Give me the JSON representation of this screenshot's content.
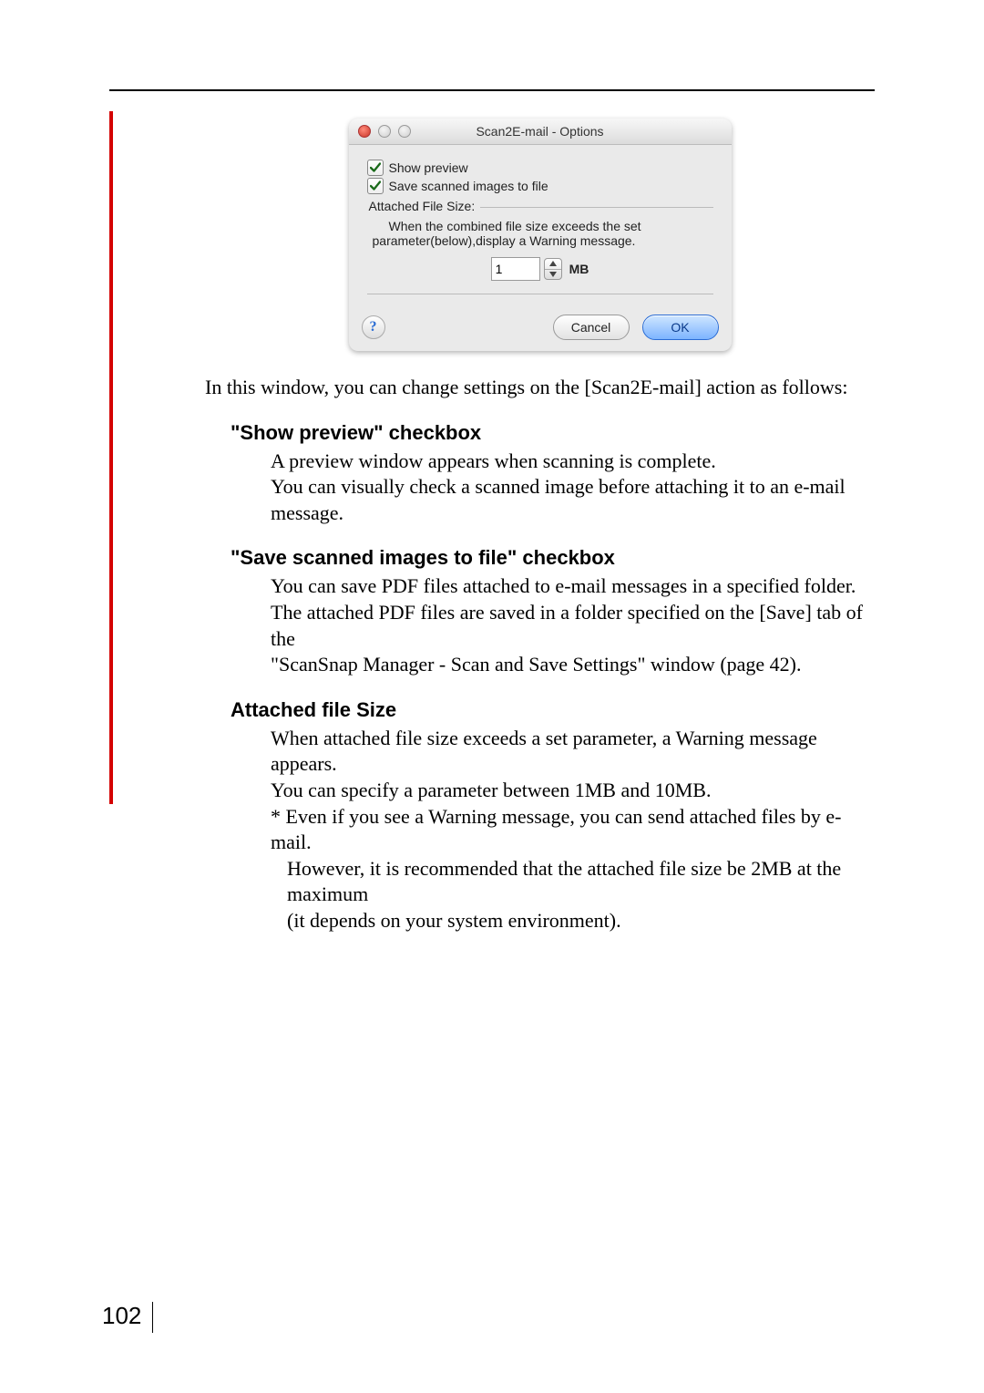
{
  "dialog": {
    "title": "Scan2E-mail - Options",
    "checkbox1_label": "Show preview",
    "checkbox2_label": "Save scanned images to file",
    "fieldset_legend": "Attached File Size:",
    "fieldset_text1": "When the combined file size exceeds the set",
    "fieldset_text2": "parameter(below),display a Warning message.",
    "stepper_value": "1",
    "stepper_unit": "MB",
    "help_label": "?",
    "cancel_label": "Cancel",
    "ok_label": "OK"
  },
  "intro": "In this window, you can change settings on the [Scan2E-mail] action as follows:",
  "sec1": {
    "heading": "\"Show preview\" checkbox",
    "line1": "A preview window appears when scanning is complete.",
    "line2": "You can visually check a scanned image before attaching it to an e-mail message."
  },
  "sec2": {
    "heading": "\"Save scanned images to file\" checkbox",
    "line1": "You can save PDF files attached to e-mail messages in a specified folder.",
    "line2": "The attached PDF files are saved in a folder specified on the [Save] tab of the",
    "line3": "\"ScanSnap Manager - Scan and Save Settings\" window (page 42)."
  },
  "sec3": {
    "heading": "Attached file Size",
    "line1": "When attached file size exceeds a set parameter, a Warning message appears.",
    "line2": "You can specify a parameter between 1MB and 10MB.",
    "note1": "* Even if you see a Warning message, you can send attached files by e-mail.",
    "note2": "However, it is recommended that the attached file size be 2MB at the maximum",
    "note3": "(it depends on your system environment)."
  },
  "page_number": "102"
}
